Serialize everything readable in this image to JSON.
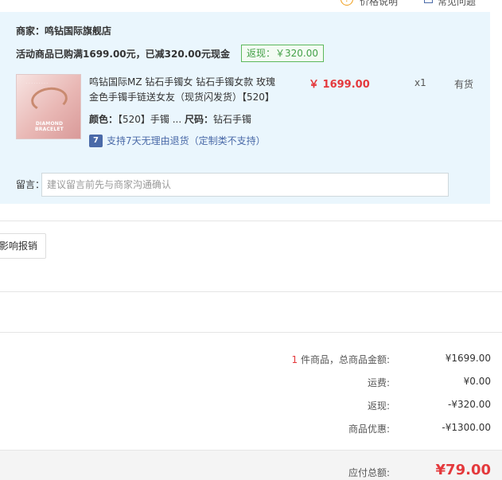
{
  "topbar": {
    "help_label": "价格说明",
    "other_label": "常见问题"
  },
  "shop": {
    "name": "商家：鸣钻国际旗舰店",
    "promo_text": "活动商品已购满1699.00元，已减320.00元现金",
    "rebate_tag": "返现：￥320.00"
  },
  "product": {
    "thumb_brand": "DIAMOND BRACELET",
    "title": "鸣钻国际MZ 钻石手镯女 钻石手镯女款 玫瑰金色手镯手链送女友（现货闪发货）【520】",
    "price": "￥ 1699.00",
    "qty": "x1",
    "stock": "有货",
    "spec_color_label": "颜色：",
    "spec_color_value": "【520】手镯 ...",
    "spec_size_label": "尺码：",
    "spec_size_value": "钻石手镯",
    "return_icon": "7",
    "return_text": "支持7天无理由退货（定制类不支持）"
  },
  "note": {
    "label": "留言：",
    "placeholder": "建议留言前先与商家沟通确认"
  },
  "invoice": {
    "button_label": "影响报销"
  },
  "summary": {
    "count": "1",
    "count_suffix": " 件商品，总商品金额:",
    "total_goods": "¥1699.00",
    "shipping_label": "运费:",
    "shipping": "¥0.00",
    "rebate_label": "返现:",
    "rebate": "-¥320.00",
    "discount_label": "商品优惠:",
    "discount": "-¥1300.00",
    "payable_label": "应付总额:",
    "payable": "¥79.00"
  },
  "colors": {
    "accent_red": "#e4393c",
    "shop_bg": "#eaf6fd",
    "rebate_green": "#43a047",
    "link_blue": "#4a6aa8"
  },
  "icons": {
    "help": "question-circle-icon",
    "return": "seven-day-return-icon"
  }
}
